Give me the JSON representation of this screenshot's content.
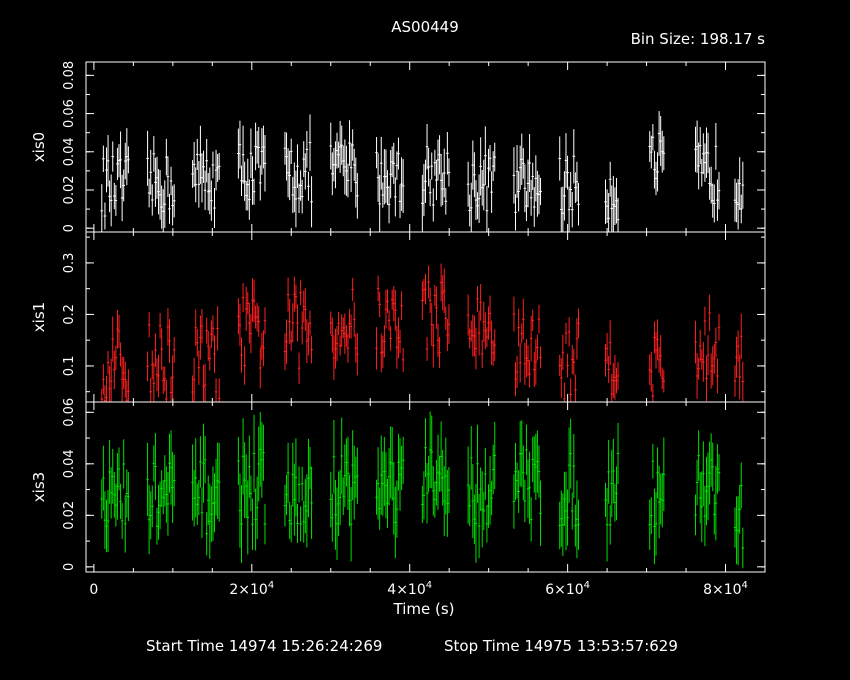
{
  "header": {
    "title": "AS00449",
    "bin_size_label": "Bin Size: 198.17 s"
  },
  "footer": {
    "start_label": "Start Time 14974 15:26:24:269",
    "stop_label": "Stop Time 14975 13:53:57:629"
  },
  "colors": {
    "background": "#000000",
    "frame": "#ffffff",
    "xis0": "#ffffff",
    "xis1": "#ff2020",
    "xis3": "#00e000"
  },
  "chart_data": {
    "type": "scatter",
    "title": "AS00449",
    "xlabel": "Time (s)",
    "xlim": [
      -1000,
      85000
    ],
    "x_ticks": [
      0,
      20000,
      40000,
      60000,
      80000
    ],
    "x_tick_labels": [
      {
        "mant": "0",
        "exp": ""
      },
      {
        "mant": "2×10",
        "exp": "4"
      },
      {
        "mant": "4×10",
        "exp": "4"
      },
      {
        "mant": "6×10",
        "exp": "4"
      },
      {
        "mant": "8×10",
        "exp": "4"
      }
    ],
    "bin_size_s": 198.17,
    "orbit_segments": [
      [
        1000,
        4500
      ],
      [
        6800,
        10200
      ],
      [
        12500,
        16000
      ],
      [
        18300,
        21800
      ],
      [
        24200,
        27700
      ],
      [
        30000,
        33500
      ],
      [
        35800,
        39200
      ],
      [
        41600,
        45000
      ],
      [
        47400,
        50800
      ],
      [
        53200,
        56600
      ],
      [
        59000,
        61500
      ],
      [
        64800,
        66400
      ],
      [
        70400,
        72300
      ],
      [
        76200,
        79200
      ],
      [
        81200,
        82200
      ]
    ],
    "panels": [
      {
        "name": "xis0",
        "ylabel": "xis0",
        "ylim": [
          -0.002,
          0.087
        ],
        "y_ticks": [
          0,
          0.02,
          0.04,
          0.06,
          0.08
        ],
        "y_tick_labels": [
          "0",
          "0.02",
          "0.04",
          "0.06",
          "0.08"
        ],
        "mean": [
          0.022,
          0.023,
          0.026,
          0.03,
          0.029,
          0.031,
          0.027,
          0.028,
          0.024,
          0.022,
          0.022,
          0.02,
          0.034,
          0.028,
          0.026
        ],
        "amp": 0.016,
        "err": 0.011
      },
      {
        "name": "xis1",
        "ylabel": "xis1",
        "ylim": [
          0.03,
          0.36
        ],
        "y_ticks": [
          0.1,
          0.2,
          0.3
        ],
        "y_tick_labels": [
          "0.1",
          "0.2",
          "0.3"
        ],
        "mean": [
          0.1,
          0.11,
          0.11,
          0.16,
          0.17,
          0.18,
          0.18,
          0.2,
          0.17,
          0.13,
          0.11,
          0.12,
          0.1,
          0.13,
          0.14
        ],
        "amp": 0.075,
        "err": 0.032
      },
      {
        "name": "xis3",
        "ylabel": "xis3",
        "ylim": [
          -0.002,
          0.064
        ],
        "y_ticks": [
          0,
          0.02,
          0.04,
          0.06
        ],
        "y_tick_labels": [
          "0",
          "0.02",
          "0.04",
          "0.06"
        ],
        "mean": [
          0.026,
          0.027,
          0.027,
          0.031,
          0.025,
          0.031,
          0.03,
          0.032,
          0.03,
          0.032,
          0.029,
          0.03,
          0.03,
          0.031,
          0.022
        ],
        "amp": 0.015,
        "err": 0.011
      }
    ]
  }
}
